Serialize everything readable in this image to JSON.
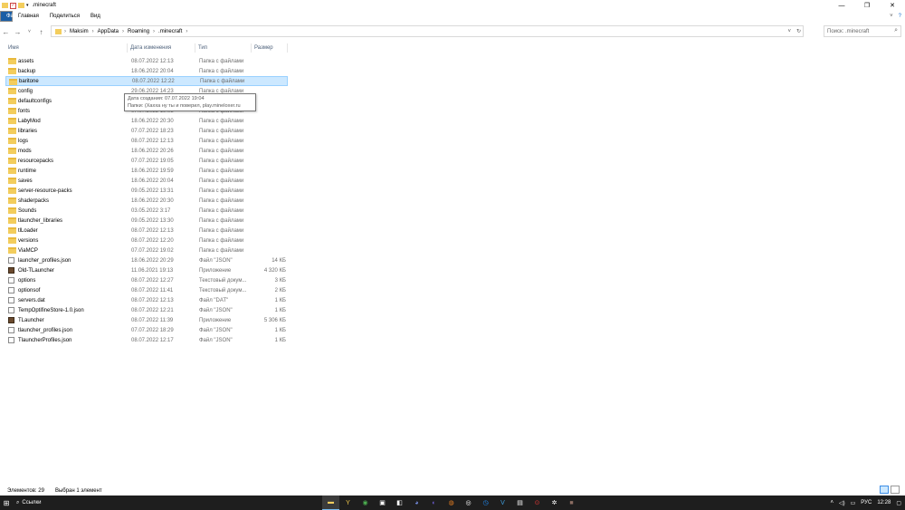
{
  "window": {
    "title": ".minecraft",
    "controls": [
      "minimize-icon",
      "maximize-icon",
      "close-icon"
    ]
  },
  "ribbon": {
    "tabs": [
      "Файл",
      "Главная",
      "Поделиться",
      "Вид"
    ]
  },
  "nav": {
    "path": [
      "Maksim",
      "AppData",
      "Roaming",
      ".minecraft"
    ],
    "search_placeholder": "Поиск: .minecraft"
  },
  "columns": {
    "name": "Имя",
    "date": "Дата изменения",
    "type": "Тип",
    "size": "Размер"
  },
  "files": [
    {
      "name": "assets",
      "date": "08.07.2022 12:13",
      "type": "Папка с файлами",
      "size": "",
      "kind": "folder"
    },
    {
      "name": "backup",
      "date": "18.06.2022 20:04",
      "type": "Папка с файлами",
      "size": "",
      "kind": "folder"
    },
    {
      "name": "baritone",
      "date": "08.07.2022 12:22",
      "type": "Папка с файлами",
      "size": "",
      "kind": "folder",
      "selected": true
    },
    {
      "name": "config",
      "date": "29.06.2022 14:23",
      "type": "Папка с файлами",
      "size": "",
      "kind": "folder"
    },
    {
      "name": "defaultconfigs",
      "date": "",
      "type": "",
      "size": "",
      "kind": "folder"
    },
    {
      "name": "fonts",
      "date": "07.07.2022 19:03",
      "type": "Папка с файлами",
      "size": "",
      "kind": "folder"
    },
    {
      "name": "LabyMod",
      "date": "18.06.2022 20:30",
      "type": "Папка с файлами",
      "size": "",
      "kind": "folder"
    },
    {
      "name": "libraries",
      "date": "07.07.2022 18:23",
      "type": "Папка с файлами",
      "size": "",
      "kind": "folder"
    },
    {
      "name": "logs",
      "date": "08.07.2022 12:13",
      "type": "Папка с файлами",
      "size": "",
      "kind": "folder"
    },
    {
      "name": "mods",
      "date": "18.06.2022 20:26",
      "type": "Папка с файлами",
      "size": "",
      "kind": "folder"
    },
    {
      "name": "resourcepacks",
      "date": "07.07.2022 19:05",
      "type": "Папка с файлами",
      "size": "",
      "kind": "folder"
    },
    {
      "name": "runtime",
      "date": "18.06.2022 19:59",
      "type": "Папка с файлами",
      "size": "",
      "kind": "folder"
    },
    {
      "name": "saves",
      "date": "18.06.2022 20:04",
      "type": "Папка с файлами",
      "size": "",
      "kind": "folder"
    },
    {
      "name": "server-resource-packs",
      "date": "09.05.2022 13:31",
      "type": "Папка с файлами",
      "size": "",
      "kind": "folder"
    },
    {
      "name": "shaderpacks",
      "date": "18.06.2022 20:30",
      "type": "Папка с файлами",
      "size": "",
      "kind": "folder"
    },
    {
      "name": "Sounds",
      "date": "03.05.2022 3:17",
      "type": "Папка с файлами",
      "size": "",
      "kind": "folder"
    },
    {
      "name": "tlauncher_libraries",
      "date": "09.05.2022 13:30",
      "type": "Папка с файлами",
      "size": "",
      "kind": "folder"
    },
    {
      "name": "tlLoader",
      "date": "08.07.2022 12:13",
      "type": "Папка с файлами",
      "size": "",
      "kind": "folder"
    },
    {
      "name": "versions",
      "date": "08.07.2022 12:20",
      "type": "Папка с файлами",
      "size": "",
      "kind": "folder"
    },
    {
      "name": "ViaMCP",
      "date": "07.07.2022 19:02",
      "type": "Папка с файлами",
      "size": "",
      "kind": "folder"
    },
    {
      "name": "launcher_profiles.json",
      "date": "18.06.2022 20:29",
      "type": "Файл \"JSON\"",
      "size": "14 КБ",
      "kind": "file"
    },
    {
      "name": "Old-TLauncher",
      "date": "11.06.2021 19:13",
      "type": "Приложение",
      "size": "4 320 КБ",
      "kind": "app"
    },
    {
      "name": "options",
      "date": "08.07.2022 12:27",
      "type": "Текстовый докум...",
      "size": "3 КБ",
      "kind": "file"
    },
    {
      "name": "optionsof",
      "date": "08.07.2022 11:41",
      "type": "Текстовый докум...",
      "size": "2 КБ",
      "kind": "file"
    },
    {
      "name": "servers.dat",
      "date": "08.07.2022 12:13",
      "type": "Файл \"DAT\"",
      "size": "1 КБ",
      "kind": "file"
    },
    {
      "name": "TempOptifineStore-1.0.json",
      "date": "08.07.2022 12:21",
      "type": "Файл \"JSON\"",
      "size": "1 КБ",
      "kind": "file"
    },
    {
      "name": "TLauncher",
      "date": "08.07.2022 11:39",
      "type": "Приложение",
      "size": "5 306 КБ",
      "kind": "app"
    },
    {
      "name": "tlauncher_profiles.json",
      "date": "07.07.2022 18:29",
      "type": "Файл \"JSON\"",
      "size": "1 КБ",
      "kind": "file"
    },
    {
      "name": "TlauncherProfiles.json",
      "date": "08.07.2022 12:17",
      "type": "Файл \"JSON\"",
      "size": "1 КБ",
      "kind": "file"
    }
  ],
  "tooltip": {
    "line1": "Дата создания: 07.07.2022 19:04",
    "line2": "Папки: (Хахха ну ты и поверил, play.mineloxer.ru"
  },
  "status": {
    "count": "Элементов: 29",
    "selected": "Выбран 1 элемент"
  },
  "taskbar": {
    "search_label": "Ссылки",
    "lang": "РУС",
    "time": "12:28"
  }
}
